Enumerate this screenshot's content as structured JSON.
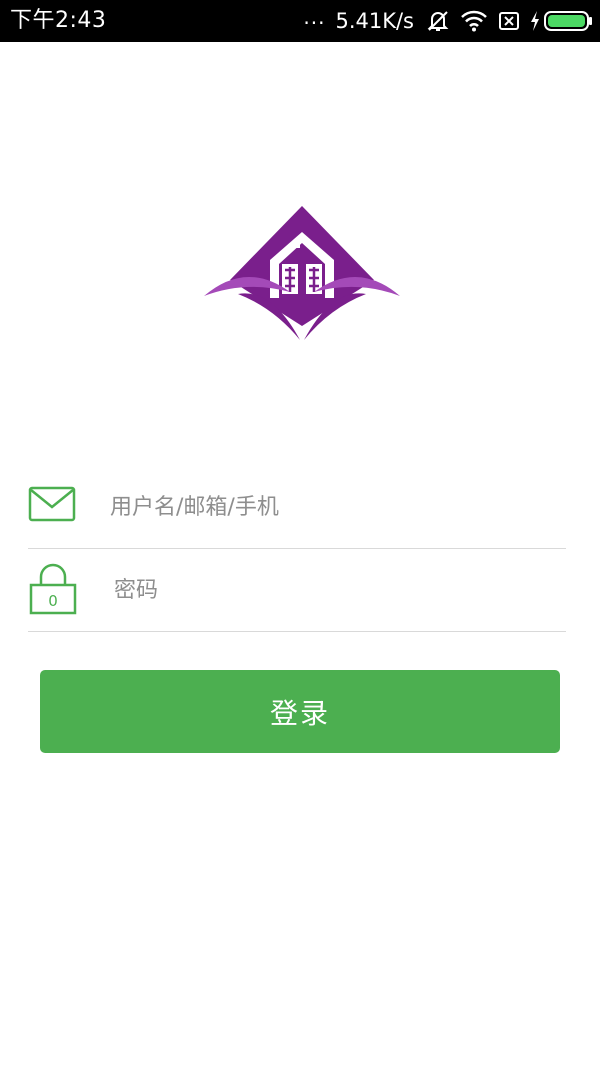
{
  "status_bar": {
    "time": "下午2:43",
    "dots": "...",
    "network_speed": "5.41K/s",
    "icons": [
      "mute-vibrate-icon",
      "wifi-icon",
      "no-sim-icon",
      "charging-icon",
      "battery-icon"
    ],
    "battery_level": 1.0,
    "battery_color": "#4cd964"
  },
  "logo": {
    "name": "logo-icon",
    "colors": {
      "primary": "#7a1f8c",
      "leaf": "#a44ab8"
    }
  },
  "form": {
    "username": {
      "placeholder": "用户名/邮箱/手机",
      "value": "",
      "icon": "envelope-icon"
    },
    "password": {
      "placeholder": "密码",
      "value": "",
      "icon": "lock-icon",
      "lock_digit": "0"
    }
  },
  "login_button": {
    "label": "登录"
  },
  "colors": {
    "accent": "#4caf50",
    "divider": "#d9d9d9",
    "placeholder": "#8e8e8e",
    "background": "#ffffff",
    "status_bar": "#000000"
  }
}
